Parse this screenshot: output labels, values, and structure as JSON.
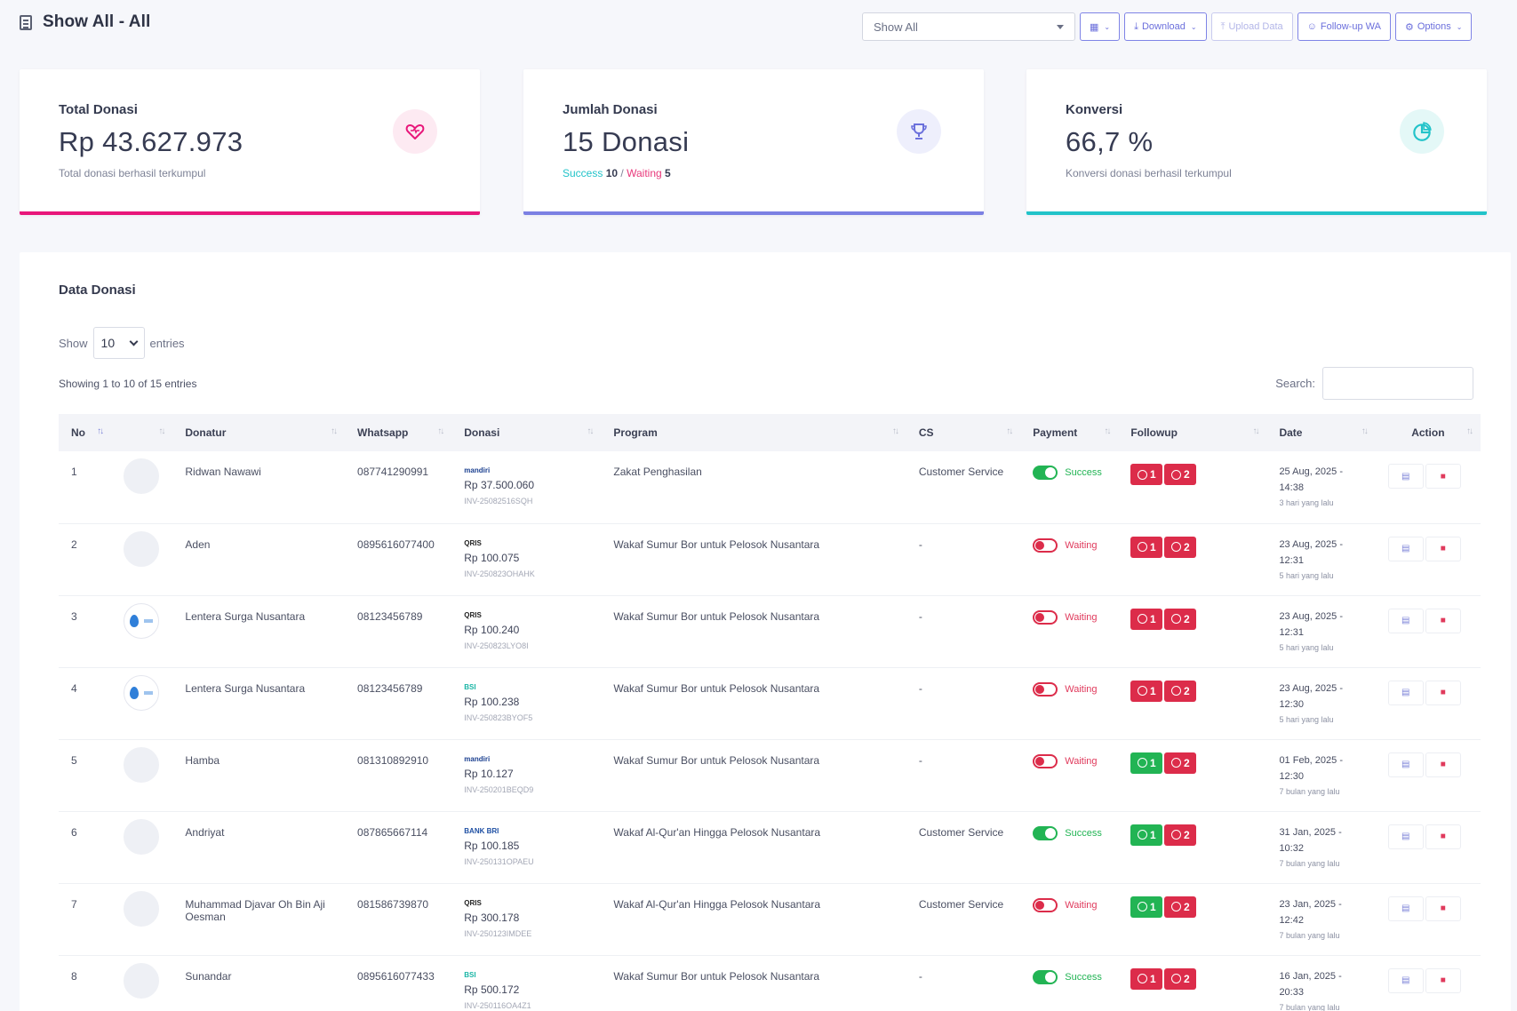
{
  "header": {
    "title": "Show All - All"
  },
  "toolbar": {
    "select_value": "Show All",
    "download": "Download",
    "upload": "Upload Data",
    "followup": "Follow-up WA",
    "options": "Options"
  },
  "cards": [
    {
      "label": "Total Donasi",
      "value": "Rp 43.627.973",
      "sub": "Total donasi berhasil terkumpul",
      "accent": "#e8177a"
    },
    {
      "label": "Jumlah Donasi",
      "value": "15 Donasi",
      "success_label": "Success",
      "success_count": "10",
      "sep": "/",
      "waiting_label": "Waiting",
      "waiting_count": "5",
      "accent": "#7b80e3"
    },
    {
      "label": "Konversi",
      "value": "66,7 %",
      "sub": "Konversi donasi berhasil terkumpul",
      "accent": "#22c3c9"
    }
  ],
  "panel": {
    "title": "Data Donasi",
    "show_label": "Show",
    "entries_value": "10",
    "entries_label": "entries",
    "info": "Showing 1 to 10 of 15 entries",
    "search_label": "Search:"
  },
  "table": {
    "headers": [
      "No",
      "",
      "Donatur",
      "Whatsapp",
      "Donasi",
      "Program",
      "CS",
      "Payment",
      "Followup",
      "Date",
      "Action"
    ],
    "rows": [
      {
        "no": "1",
        "donatur": "Ridwan Nawawi",
        "wa": "087741290991",
        "bank": "mandiri",
        "amount": "Rp 37.500.060",
        "inv": "INV-25082516SQH",
        "program": "Zakat Penghasilan",
        "cs": "Customer Service",
        "status": "Success",
        "f1": "1",
        "f2": "2",
        "date": "25 Aug, 2025 -",
        "time": "14:38",
        "ago": "3 hari yang lalu"
      },
      {
        "no": "2",
        "donatur": "Aden",
        "wa": "0895616077400",
        "bank": "QRIS",
        "amount": "Rp 100.075",
        "inv": "INV-250823OHAHK",
        "program": "Wakaf Sumur Bor untuk Pelosok Nusantara",
        "cs": "-",
        "status": "Waiting",
        "f1": "1",
        "f2": "2",
        "date": "23 Aug, 2025 -",
        "time": "12:31",
        "ago": "5 hari yang lalu"
      },
      {
        "no": "3",
        "donatur": "Lentera Surga Nusantara",
        "wa": "08123456789",
        "bank": "QRIS",
        "amount": "Rp 100.240",
        "inv": "INV-250823LYO8I",
        "program": "Wakaf Sumur Bor untuk Pelosok Nusantara",
        "cs": "-",
        "status": "Waiting",
        "f1": "1",
        "f2": "2",
        "date": "23 Aug, 2025 -",
        "time": "12:31",
        "ago": "5 hari yang lalu"
      },
      {
        "no": "4",
        "donatur": "Lentera Surga Nusantara",
        "wa": "08123456789",
        "bank": "BSI",
        "amount": "Rp 100.238",
        "inv": "INV-250823BYOF5",
        "program": "Wakaf Sumur Bor untuk Pelosok Nusantara",
        "cs": "-",
        "status": "Waiting",
        "f1": "1",
        "f2": "2",
        "date": "23 Aug, 2025 -",
        "time": "12:30",
        "ago": "5 hari yang lalu"
      },
      {
        "no": "5",
        "donatur": "Hamba",
        "wa": "081310892910",
        "bank": "mandiri",
        "amount": "Rp 10.127",
        "inv": "INV-250201BEQD9",
        "program": "Wakaf Sumur Bor untuk Pelosok Nusantara",
        "cs": "-",
        "status": "Waiting",
        "f1": "1",
        "f2": "2",
        "date": "01 Feb, 2025 -",
        "time": "12:30",
        "ago": "7 bulan yang lalu"
      },
      {
        "no": "6",
        "donatur": "Andriyat",
        "wa": "087865667114",
        "bank": "BANK BRI",
        "amount": "Rp 100.185",
        "inv": "INV-250131OPAEU",
        "program": "Wakaf Al-Qur'an Hingga Pelosok Nusantara",
        "cs": "Customer Service",
        "status": "Success",
        "f1": "1",
        "f2": "2",
        "date": "31 Jan, 2025 -",
        "time": "10:32",
        "ago": "7 bulan yang lalu"
      },
      {
        "no": "7",
        "donatur": "Muhammad Djavar Oh Bin Aji Oesman",
        "wa": "081586739870",
        "bank": "QRIS",
        "amount": "Rp 300.178",
        "inv": "INV-250123IMDEE",
        "program": "Wakaf Al-Qur'an Hingga Pelosok Nusantara",
        "cs": "Customer Service",
        "status": "Waiting",
        "f1": "1",
        "f2": "2",
        "date": "23 Jan, 2025 -",
        "time": "12:42",
        "ago": "7 bulan yang lalu"
      },
      {
        "no": "8",
        "donatur": "Sunandar",
        "wa": "0895616077433",
        "bank": "BSI",
        "amount": "Rp 500.172",
        "inv": "INV-250116OA4Z1",
        "program": "Wakaf Sumur Bor untuk Pelosok Nusantara",
        "cs": "-",
        "status": "Success",
        "f1": "1",
        "f2": "2",
        "date": "16 Jan, 2025 -",
        "time": "20:33",
        "ago": "7 bulan yang lalu"
      }
    ]
  }
}
